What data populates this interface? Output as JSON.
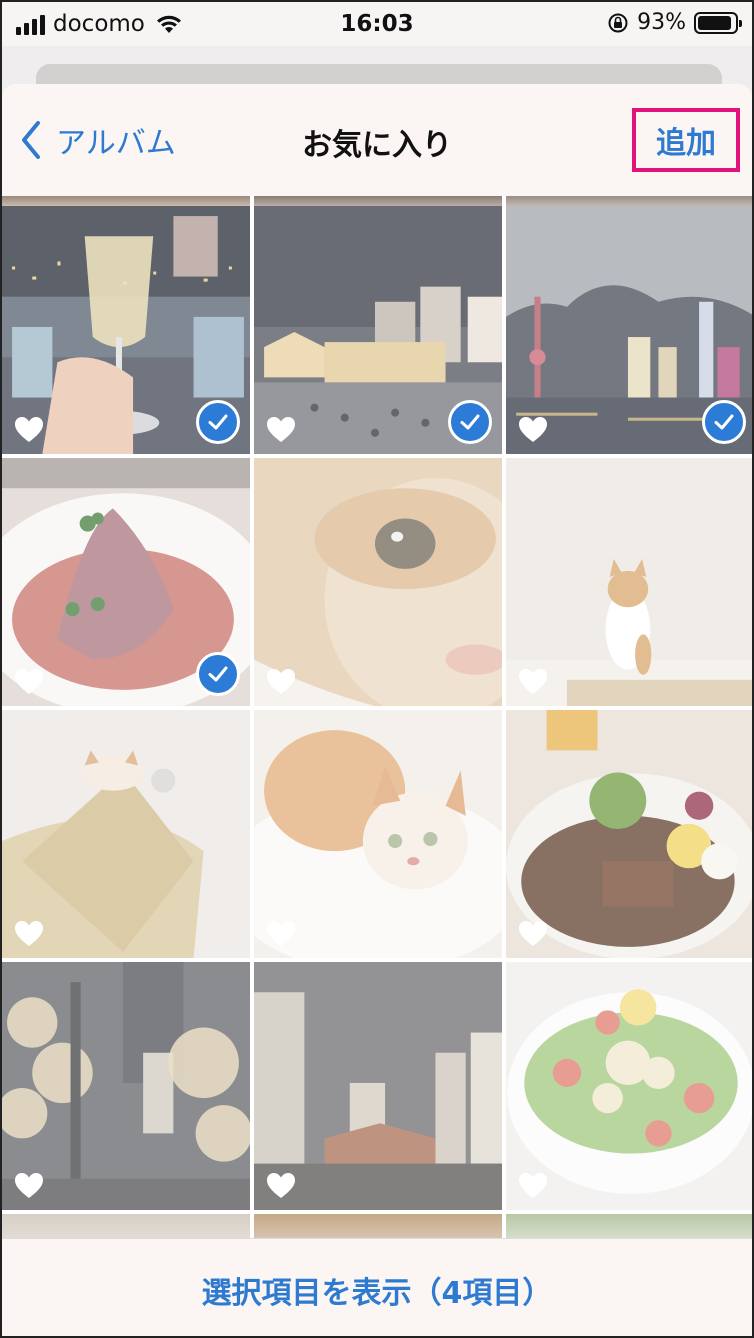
{
  "status_bar": {
    "carrier": "docomo",
    "time": "16:03",
    "battery_percent": "93%",
    "battery_level": 0.93,
    "icons": [
      "signal-icon",
      "wifi-icon",
      "rotation-lock-icon",
      "battery-icon"
    ]
  },
  "nav": {
    "back_label": "アルバム",
    "title": "お気に入り",
    "add_label": "追加",
    "accent": "#2f7ad1",
    "highlight": "#e2137a"
  },
  "photos": [
    {
      "subject": "champagne-night-view",
      "favorite": true,
      "selected": true
    },
    {
      "subject": "bund-night-buildings",
      "favorite": true,
      "selected": true
    },
    {
      "subject": "pudong-skyline-night",
      "favorite": true,
      "selected": true
    },
    {
      "subject": "roast-beef-dish",
      "favorite": true,
      "selected": true
    },
    {
      "subject": "cat-closeup",
      "favorite": true,
      "selected": false
    },
    {
      "subject": "cat-sitting-wall",
      "favorite": true,
      "selected": false
    },
    {
      "subject": "cat-on-cushion",
      "favorite": true,
      "selected": false
    },
    {
      "subject": "cat-lying-blanket",
      "favorite": true,
      "selected": false
    },
    {
      "subject": "curry-plate",
      "favorite": true,
      "selected": false
    },
    {
      "subject": "illuminated-trees",
      "favorite": true,
      "selected": false
    },
    {
      "subject": "tokyo-station-night",
      "favorite": true,
      "selected": false
    },
    {
      "subject": "salad-plate",
      "favorite": true,
      "selected": false
    }
  ],
  "toolbar": {
    "show_selected_label": "選択項目を表示（4項目）"
  }
}
